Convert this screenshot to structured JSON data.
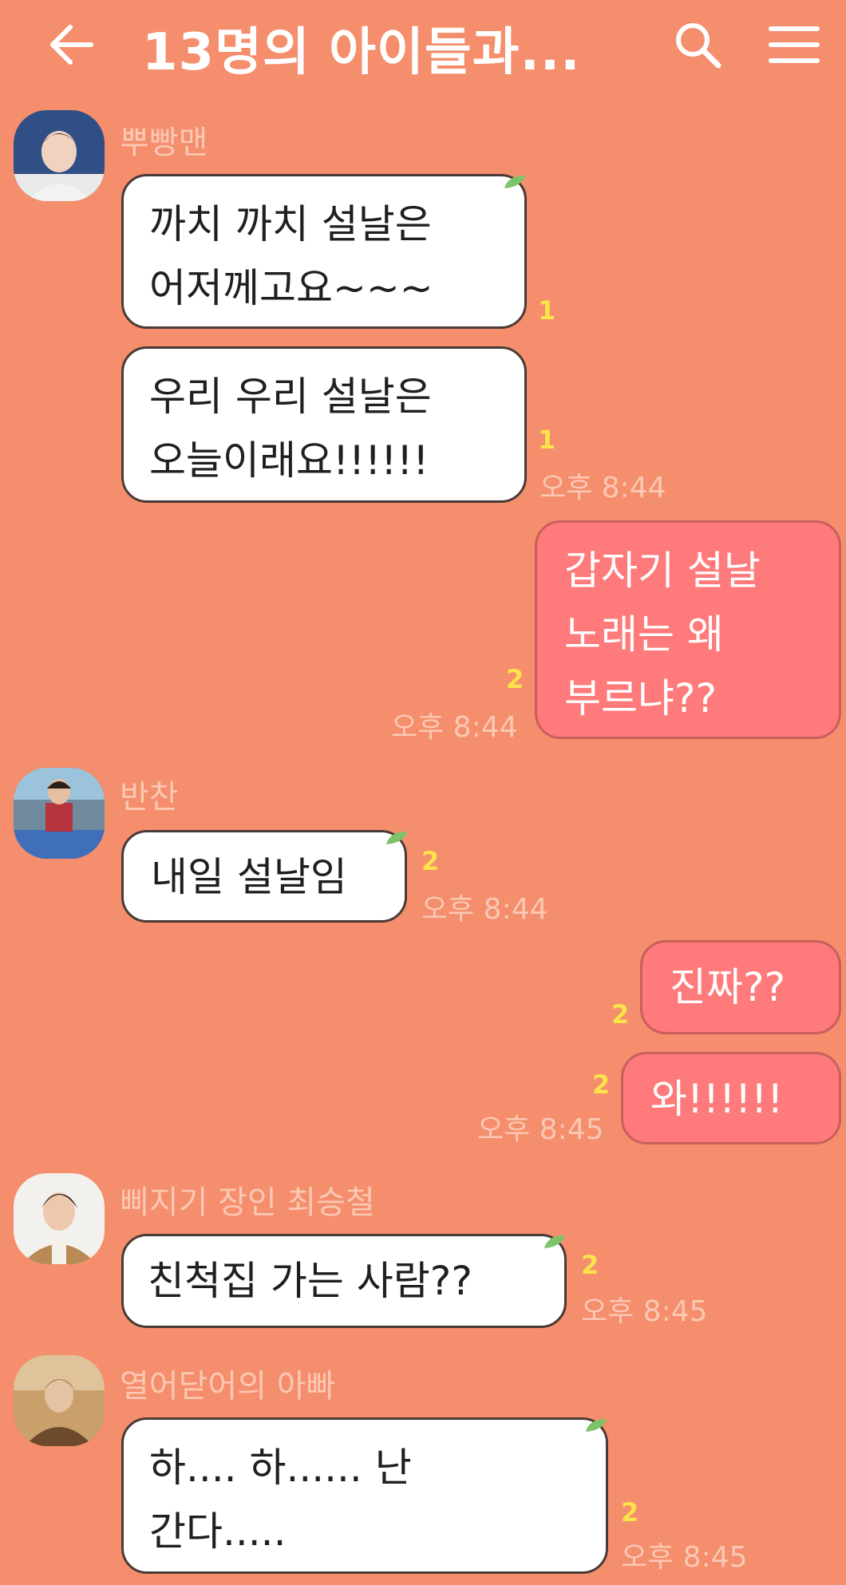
{
  "header": {
    "title": "13명의 아이들과...",
    "back_icon": "back-arrow-icon",
    "search_icon": "search-icon",
    "menu_icon": "hamburger-menu-icon"
  },
  "messages": [
    {
      "sender": "뿌빵맨",
      "bubbles": [
        {
          "text": "까치 까치 설날은\n어저께고요~~~",
          "unread": "1"
        },
        {
          "text": "우리 우리 설날은\n오늘이래요!!!!!!",
          "unread": "1",
          "time": "오후 8:44"
        }
      ]
    },
    {
      "sender": "me",
      "bubbles": [
        {
          "text": "갑자기 설날\n노래는 왜\n부르냐??",
          "unread": "2",
          "time": "오후 8:44"
        }
      ]
    },
    {
      "sender": "반찬",
      "bubbles": [
        {
          "text": "내일 설날임",
          "unread": "2",
          "time": "오후 8:44"
        }
      ]
    },
    {
      "sender": "me",
      "bubbles": [
        {
          "text": "진짜??",
          "unread": "2"
        },
        {
          "text": "와!!!!!!",
          "unread": "2",
          "time": "오후 8:45"
        }
      ]
    },
    {
      "sender": "삐지기 장인 최승철",
      "bubbles": [
        {
          "text": "친척집 가는 사람??",
          "unread": "2",
          "time": "오후 8:45"
        }
      ]
    },
    {
      "sender": "열어닫어의 아빠",
      "bubbles": [
        {
          "text": "하.... 하...... 난\n간다.....",
          "unread": "2",
          "time": "오후 8:45"
        }
      ]
    }
  ],
  "colors": {
    "background": "#f48e6c",
    "incoming_bubble": "#ffffff",
    "outgoing_bubble": "#ff7a7a",
    "unread": "#fbe34b",
    "meta_text": "#fbc8b4"
  }
}
